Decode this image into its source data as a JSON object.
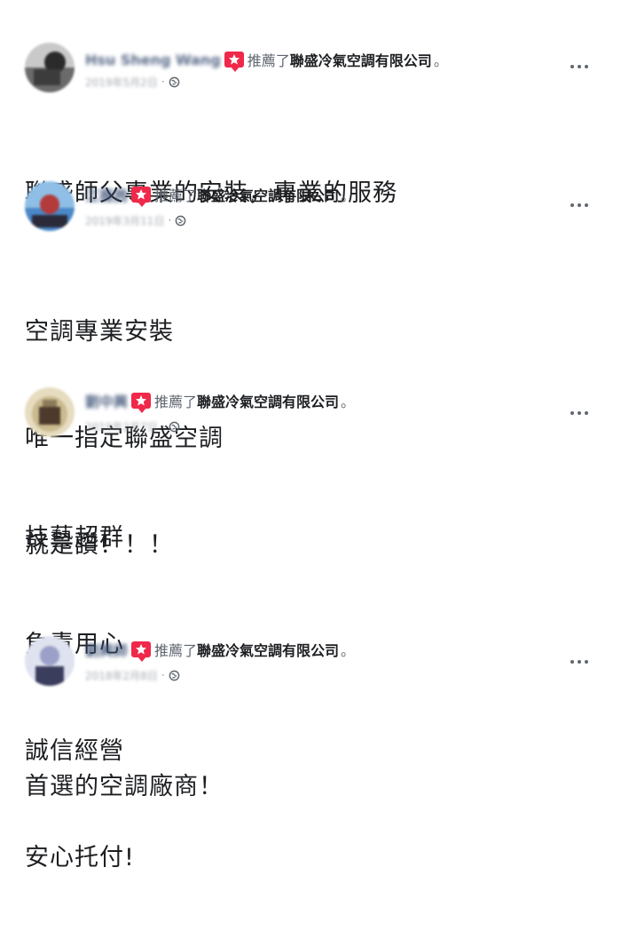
{
  "posts": [
    {
      "author": "Hsu Sheng Wang",
      "verb": "推薦了",
      "page": "聯盛冷氣空調有限公司",
      "period": "。",
      "date": "2019年5月2日",
      "sep": "·",
      "lines": [
        "聯盛師父專業的安裝，專業的服務"
      ],
      "avatar_colors": [
        "#6b6b6b",
        "#2b2b2b",
        "#c9c9c9"
      ]
    },
    {
      "author": "江薇茜",
      "verb": "推薦了",
      "page": "聯盛冷氣空調有限公司",
      "period": "。",
      "date": "2019年3月11日",
      "sep": "·",
      "lines": [
        "空調專業安裝",
        "唯一指定聯盛空調",
        "就是讚！！！"
      ],
      "avatar_colors": [
        "#4a88c8",
        "#b33b3b",
        "#8fbfe6"
      ]
    },
    {
      "author": "劉中興",
      "verb": "推薦了",
      "page": "聯盛冷氣空調有限公司",
      "period": "。",
      "date": "2019年2月7日",
      "sep": "·",
      "lines": [
        "技藝超群",
        "負責用心",
        "誠信經營",
        "安心托付!"
      ],
      "avatar_colors": [
        "#cbbb8f",
        "#4d3a2c",
        "#e6dcc0"
      ]
    },
    {
      "author": "劉興師",
      "verb": "推薦了",
      "page": "聯盛冷氣空調有限公司",
      "period": "。",
      "date": "2018年2月8日",
      "sep": "·",
      "lines": [
        "首選的空調廠商！"
      ],
      "avatar_colors": [
        "#9aa0c8",
        "#3a3d5c",
        "#dfe2ef"
      ]
    }
  ],
  "icons": {
    "recommend": "recommend-icon",
    "privacy": "globe-icon",
    "menu": "more-options-icon"
  },
  "colors": {
    "recommend_badge": "#f0284a",
    "meta_text": "#90949c",
    "body_text": "#1c1e21"
  }
}
